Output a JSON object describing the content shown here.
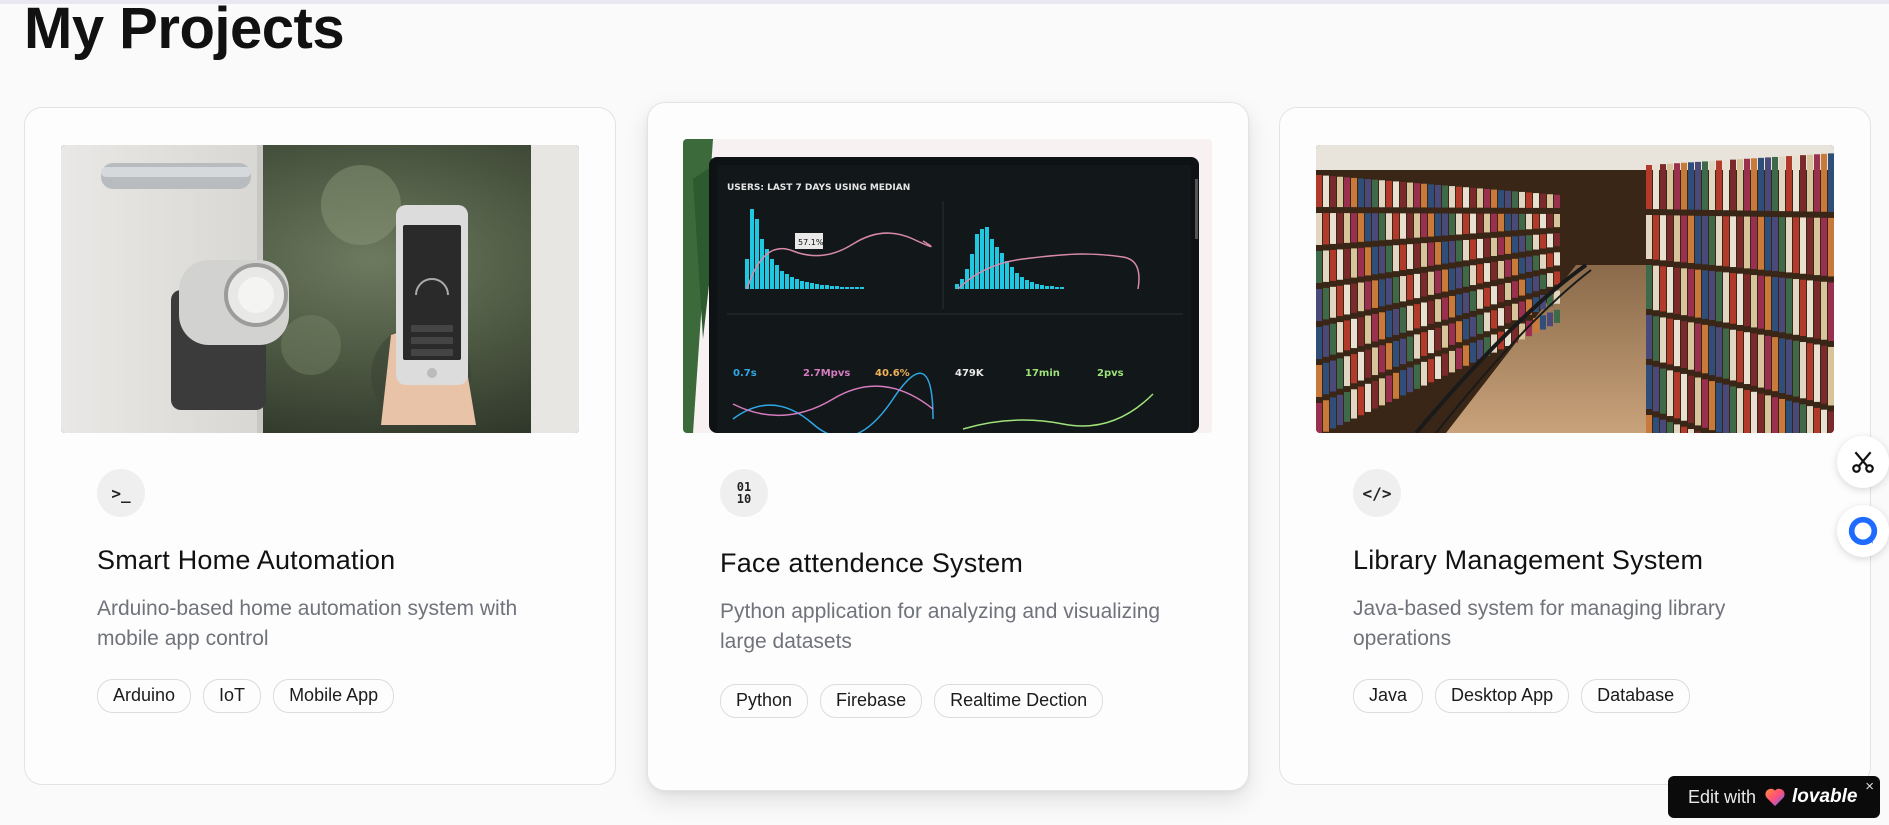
{
  "page": {
    "title": "My Projects"
  },
  "projects": [
    {
      "icon_name": "terminal-icon",
      "icon_glyph": ">_",
      "title": "Smart Home Automation",
      "description": "Arduino-based home automation system with mobile app control",
      "tags": [
        "Arduino",
        "IoT",
        "Mobile App"
      ]
    },
    {
      "icon_name": "binary-icon",
      "icon_glyph": "01\n10",
      "title": "Face attendence System",
      "description": "Python application for analyzing and visualizing large datasets",
      "tags": [
        "Python",
        "Firebase",
        "Realtime Dection"
      ]
    },
    {
      "icon_name": "code-icon",
      "icon_glyph": "</>",
      "title": "Library Management System",
      "description": "Java-based system for managing library operations",
      "tags": [
        "Java",
        "Desktop App",
        "Database"
      ]
    }
  ],
  "dashboard_image": {
    "header": "USERS: LAST 7 DAYS USING MEDIAN",
    "metrics": [
      "0.7s",
      "2.7Mpvs",
      "40.6%",
      "479K",
      "17min",
      "2pvs"
    ],
    "tooltip": "57.1%"
  },
  "side_buttons": [
    {
      "name": "scissors-icon"
    },
    {
      "name": "chat-icon"
    }
  ],
  "badge": {
    "edit_text": "Edit with",
    "brand": "lovable",
    "close": "×"
  },
  "colors": {
    "background": "#fafafb",
    "card_border": "#e3e3e6",
    "muted_text": "#70737a",
    "chart_cyan": "#1fc8e0"
  }
}
